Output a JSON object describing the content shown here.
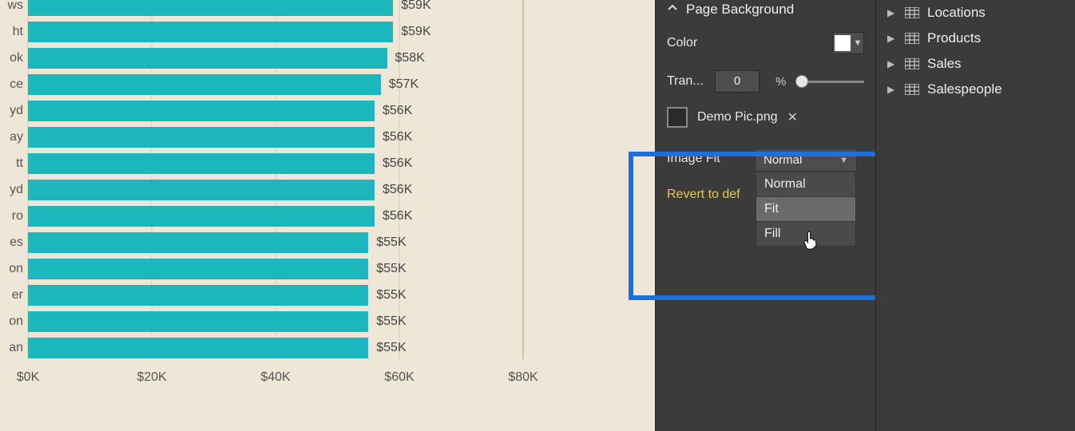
{
  "chart_data": {
    "type": "bar",
    "orientation": "horizontal",
    "xlabel": "",
    "ylabel": "",
    "xlim": [
      0,
      80
    ],
    "ticks": [
      0,
      20,
      40,
      60,
      80
    ],
    "tick_labels": [
      "$0K",
      "$20K",
      "$40K",
      "$60K",
      "$80K"
    ],
    "categories": [
      "ws",
      "ht",
      "ok",
      "ce",
      "yd",
      "ay",
      "tt",
      "yd",
      "ro",
      "es",
      "on",
      "er",
      "on",
      "an"
    ],
    "values": [
      59,
      59,
      58,
      57,
      56,
      56,
      56,
      56,
      56,
      55,
      55,
      55,
      55,
      55
    ],
    "value_labels": [
      "$59K",
      "$59K",
      "$58K",
      "$57K",
      "$56K",
      "$56K",
      "$56K",
      "$56K",
      "$56K",
      "$55K",
      "$55K",
      "$55K",
      "$55K",
      "$55K"
    ],
    "color": "#1cb6bd"
  },
  "format": {
    "section_title": "Page Background",
    "color_label": "Color",
    "color_value": "#ffffff",
    "transparency_label": "Tran...",
    "transparency_value": "0",
    "transparency_unit": "%",
    "image_file": "Demo Pic.png",
    "image_fit_label": "Image Fit",
    "image_fit_selected": "Normal",
    "image_fit_options": [
      "Normal",
      "Fit",
      "Fill"
    ],
    "revert_label": "Revert to def"
  },
  "fields": {
    "items": [
      {
        "label": "Locations"
      },
      {
        "label": "Products"
      },
      {
        "label": "Sales"
      },
      {
        "label": "Salespeople"
      }
    ]
  }
}
